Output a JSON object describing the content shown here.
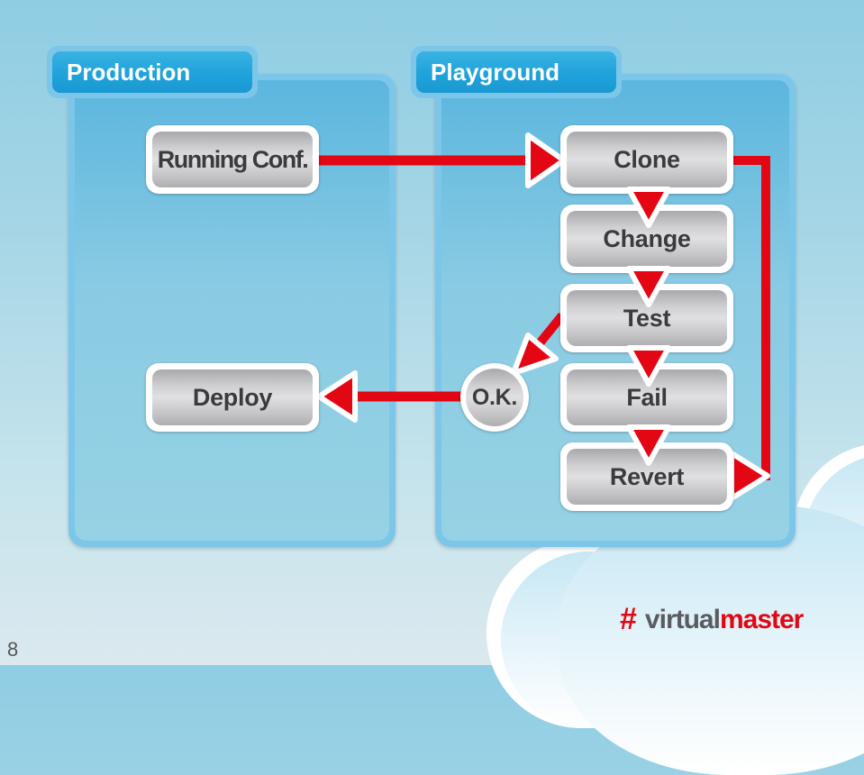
{
  "slide": {
    "page_number": "8",
    "colors": {
      "arrow": "#e30613",
      "panel": "#7cc6ea",
      "tab": "#1fa3da",
      "node_text": "#3b3b3d"
    }
  },
  "panels": {
    "production": {
      "title": "Production"
    },
    "playground": {
      "title": "Playground"
    }
  },
  "nodes": {
    "running_conf": "Running Conf.",
    "deploy": "Deploy",
    "clone": "Clone",
    "change": "Change",
    "test": "Test",
    "fail": "Fail",
    "revert": "Revert",
    "ok": "O.K."
  },
  "edges": [
    {
      "from": "Running Conf.",
      "to": "Clone"
    },
    {
      "from": "Clone",
      "to": "Change"
    },
    {
      "from": "Change",
      "to": "Test"
    },
    {
      "from": "Test",
      "to": "Fail"
    },
    {
      "from": "Fail",
      "to": "Revert"
    },
    {
      "from": "Test",
      "to": "O.K."
    },
    {
      "from": "O.K.",
      "to": "Deploy"
    },
    {
      "from": "Clone",
      "to": "Revert",
      "route": "right-side loop"
    }
  ],
  "logo": {
    "hash": "#",
    "part1": "virtual",
    "part2": "master"
  }
}
